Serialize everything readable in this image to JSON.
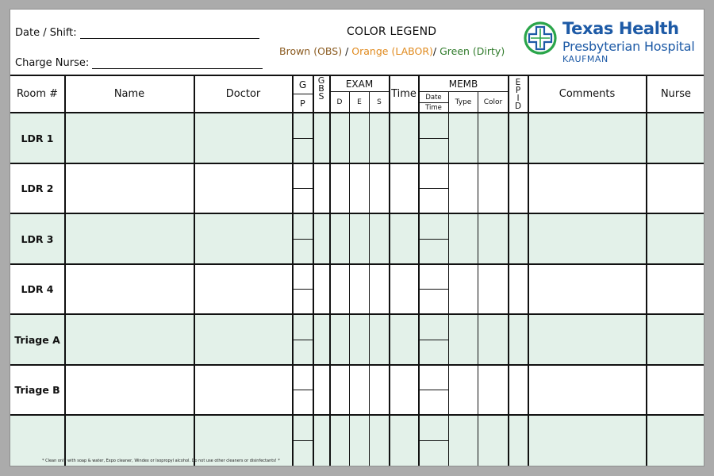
{
  "header": {
    "date_shift_label": "Date / Shift:",
    "charge_nurse_label": "Charge Nurse:",
    "legend_title": "COLOR LEGEND",
    "legend_brown": "Brown (OBS)",
    "legend_sep1": "/",
    "legend_orange": "Orange (LABOR)",
    "legend_sep2": "/",
    "legend_green": "Green (Dirty)"
  },
  "logo": {
    "line1": "Texas Health",
    "line2": "Presbyterian Hospital",
    "line3": "KAUFMAN"
  },
  "colors": {
    "band_green": "#e3f1e9",
    "logo_blue": "#1d5aa6",
    "logo_green": "#2aa54a",
    "legend_brown": "#8a5a1f",
    "legend_orange": "#e08a1e",
    "legend_green": "#2f7a2a"
  },
  "columns": {
    "room": "Room #",
    "name": "Name",
    "doctor": "Doctor",
    "g": "G",
    "p": "P",
    "gbs": [
      "G",
      "B",
      "S"
    ],
    "exam": "EXAM",
    "exam_d": "D",
    "exam_e": "E",
    "exam_s": "S",
    "time": "Time",
    "memb": "MEMB",
    "memb_date": "Date",
    "memb_time": "Time",
    "memb_type": "Type",
    "memb_color": "Color",
    "epid": [
      "E",
      "P",
      "I",
      "D"
    ],
    "comments": "Comments",
    "nurse": "Nurse"
  },
  "rooms": [
    "LDR 1",
    "LDR 2",
    "LDR 3",
    "LDR 4",
    "Triage A",
    "Triage B",
    ""
  ],
  "footnote": "* Clean only with soap & water, Expo cleaner, Windex or Isopropyl alcohol. Do not use other cleaners or disinfectants! *"
}
